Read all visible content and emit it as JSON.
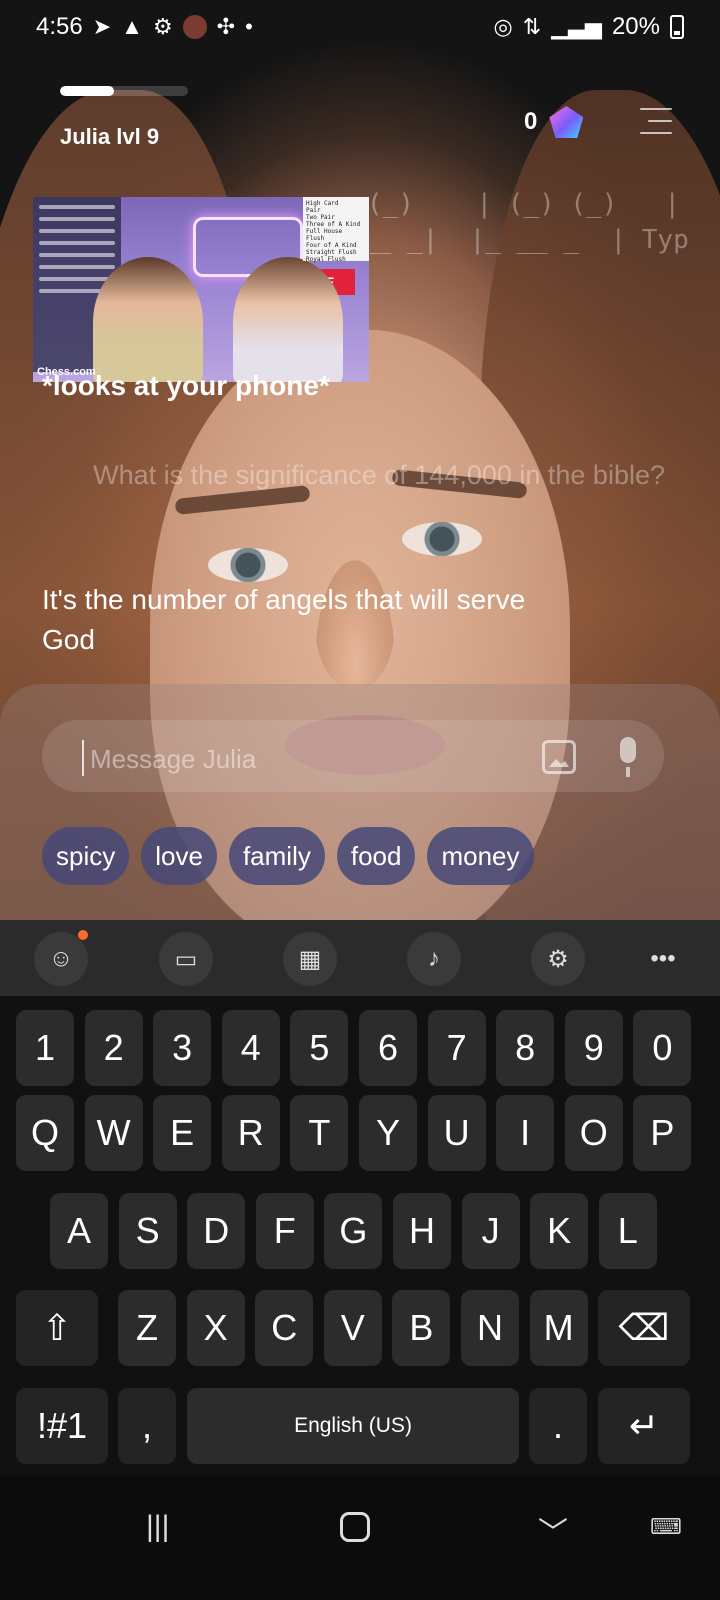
{
  "status_bar": {
    "time": "4:56",
    "battery": "20%",
    "left_icons": [
      "telegram-icon",
      "warning-icon",
      "settings-icon",
      "avatar-icon",
      "pinwheel-icon",
      "dot-icon"
    ],
    "right_icons": [
      "hotspot-icon",
      "data-icon",
      "signal-icon",
      "battery-icon"
    ]
  },
  "header": {
    "level_label": "Julia lvl 9",
    "level_progress": 0.42,
    "gem_count": "0",
    "menu_icon": "menu-icon"
  },
  "ascii_art": {
    "line1": "(_)    | (_) (_)   |",
    "line2": "__ _|  |_ __ _  | Typ"
  },
  "thumbnail": {
    "sign_text": "B",
    "live_badge": "VE",
    "brand_text": "Chess.com",
    "poker_lines": [
      "High Card",
      "Pair",
      "Two Pair",
      "Three of A Kind",
      "Full House",
      "Flush",
      "Four of A Kind",
      "Straight Flush",
      "Royal Flush"
    ]
  },
  "messages": {
    "action": "*looks at your phone*",
    "user": "What is the significance of 144,000 in the bible?",
    "ai": "It's the number of angels that will serve God"
  },
  "input": {
    "placeholder": "Message Julia",
    "image_icon": "image-icon",
    "mic_icon": "microphone-icon"
  },
  "chips": [
    "spicy",
    "love",
    "family",
    "food",
    "money"
  ],
  "keyboard": {
    "toolbar_icons": [
      "emoji-icon",
      "clipboard-icon",
      "keypad-icon",
      "voice-icon",
      "gear-icon",
      "more-icon"
    ],
    "row_numbers": [
      "1",
      "2",
      "3",
      "4",
      "5",
      "6",
      "7",
      "8",
      "9",
      "0"
    ],
    "row1": [
      "Q",
      "W",
      "E",
      "R",
      "T",
      "Y",
      "U",
      "I",
      "O",
      "P"
    ],
    "row2": [
      "A",
      "S",
      "D",
      "F",
      "G",
      "H",
      "J",
      "K",
      "L"
    ],
    "row3": [
      "Z",
      "X",
      "C",
      "V",
      "B",
      "N",
      "M"
    ],
    "symbols_label": "!#1",
    "comma_label": ",",
    "space_label": "English (US)",
    "period_label": ".",
    "shift_icon": "shift-icon",
    "backspace_icon": "backspace-icon",
    "enter_icon": "enter-icon"
  },
  "navbar": {
    "recents_icon": "recents-icon",
    "home_icon": "home-icon",
    "back_icon": "back-icon",
    "keyboard_icon": "keyboard-hide-icon"
  }
}
